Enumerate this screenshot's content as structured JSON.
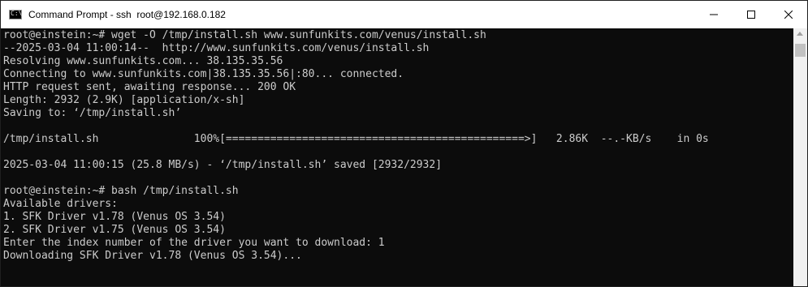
{
  "window": {
    "title": "Command Prompt - ssh  root@192.168.0.182",
    "icon": "cmd-icon",
    "controls": [
      "minimize-icon",
      "maximize-icon",
      "close-icon"
    ]
  },
  "terminal": {
    "lines": [
      "root@einstein:~# wget -O /tmp/install.sh www.sunfunkits.com/venus/install.sh",
      "--2025-03-04 11:00:14--  http://www.sunfunkits.com/venus/install.sh",
      "Resolving www.sunfunkits.com... 38.135.35.56",
      "Connecting to www.sunfunkits.com|38.135.35.56|:80... connected.",
      "HTTP request sent, awaiting response... 200 OK",
      "Length: 2932 (2.9K) [application/x-sh]",
      "Saving to: ‘/tmp/install.sh’",
      "",
      "/tmp/install.sh               100%[===============================================>]   2.86K  --.-KB/s    in 0s",
      "",
      "2025-03-04 11:00:15 (25.8 MB/s) - ‘/tmp/install.sh’ saved [2932/2932]",
      "",
      "root@einstein:~# bash /tmp/install.sh",
      "Available drivers:",
      "1. SFK Driver v1.78 (Venus OS 3.54)",
      "2. SFK Driver v1.75 (Venus OS 3.54)",
      "Enter the index number of the driver you want to download: 1",
      "Downloading SFK Driver v1.78 (Venus OS 3.54)..."
    ],
    "background_color": "#0c0c0c",
    "text_color": "#cccccc"
  }
}
